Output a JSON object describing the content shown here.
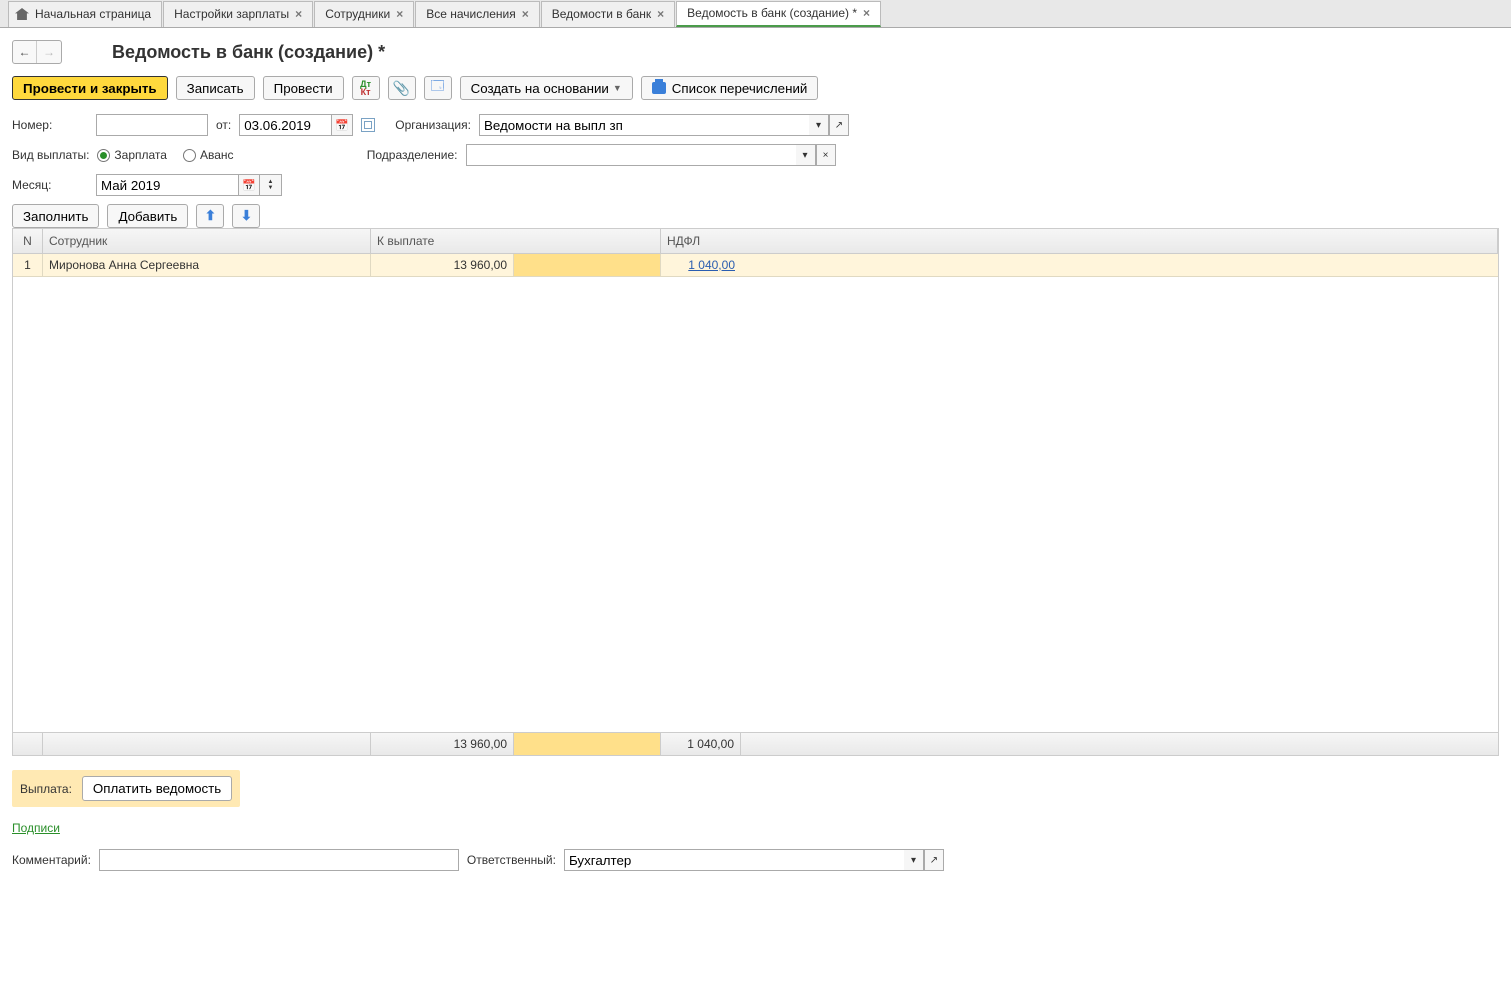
{
  "tabs": [
    {
      "label": "Начальная страница",
      "closable": false
    },
    {
      "label": "Настройки зарплаты"
    },
    {
      "label": "Сотрудники"
    },
    {
      "label": "Все начисления"
    },
    {
      "label": "Ведомости в банк"
    },
    {
      "label": "Ведомость в банк (создание) *",
      "active": true
    }
  ],
  "page_title": "Ведомость в банк (создание) *",
  "toolbar": {
    "post_close": "Провести и закрыть",
    "save": "Записать",
    "post": "Провести",
    "create_based": "Создать на основании",
    "transfer_list": "Список перечислений"
  },
  "form": {
    "number_label": "Номер:",
    "number_value": "",
    "from_label": "от:",
    "date_value": "03.06.2019",
    "org_label": "Организация:",
    "org_value": "Ведомости на выпл зп",
    "paytype_label": "Вид выплаты:",
    "paytype_opts": {
      "salary": "Зарплата",
      "advance": "Аванс"
    },
    "sub_label": "Подразделение:",
    "sub_value": "",
    "month_label": "Месяц:",
    "month_value": "Май 2019"
  },
  "table_toolbar": {
    "fill": "Заполнить",
    "add": "Добавить"
  },
  "table": {
    "headers": {
      "n": "N",
      "emp": "Сотрудник",
      "pay": "К выплате",
      "tax": "НДФЛ"
    },
    "rows": [
      {
        "n": "1",
        "emp": "Миронова Анна Сергеевна",
        "pay": "13 960,00",
        "tax": "1 040,00"
      }
    ],
    "footer": {
      "pay": "13 960,00",
      "tax": "1 040,00"
    }
  },
  "payment": {
    "label": "Выплата:",
    "button": "Оплатить ведомость"
  },
  "signatures_link": "Подписи",
  "bottom": {
    "comment_label": "Комментарий:",
    "comment_value": "",
    "resp_label": "Ответственный:",
    "resp_value": "Бухгалтер"
  }
}
